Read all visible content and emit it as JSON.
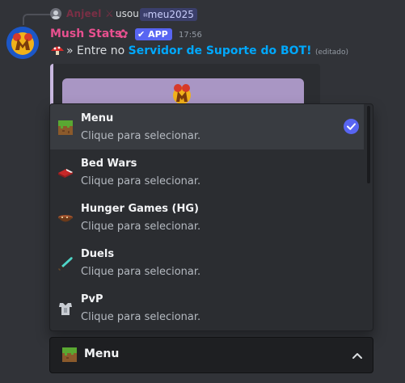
{
  "reply": {
    "user": "Anjeel",
    "used": "usou",
    "command": "meu2025"
  },
  "message": {
    "username": "Mush Stats",
    "app_tag": "APP",
    "timestamp": "17:56",
    "text_before": "» Entre no ",
    "link_text": "Servidor de Suporte do BOT!",
    "edited": "(editado)"
  },
  "menu": {
    "options": [
      {
        "label": "Menu",
        "description": "Clique para selecionar.",
        "icon": "grass-block-icon",
        "selected": true
      },
      {
        "label": "Bed Wars",
        "description": "Clique para selecionar.",
        "icon": "bed-icon",
        "selected": false
      },
      {
        "label": "Hunger Games (HG)",
        "description": "Clique para selecionar.",
        "icon": "stew-bowl-icon",
        "selected": false
      },
      {
        "label": "Duels",
        "description": "Clique para selecionar.",
        "icon": "diamond-sword-icon",
        "selected": false
      },
      {
        "label": "PvP",
        "description": "Clique para selecionar.",
        "icon": "chestplate-icon",
        "selected": false
      }
    ]
  },
  "select": {
    "value": "Menu",
    "icon": "grass-block-icon"
  },
  "colors": {
    "background": "#313338",
    "username": "#e8508f",
    "link": "#00a8fc",
    "accent": "#5865f2",
    "embed_border": "#c9b8e0"
  }
}
